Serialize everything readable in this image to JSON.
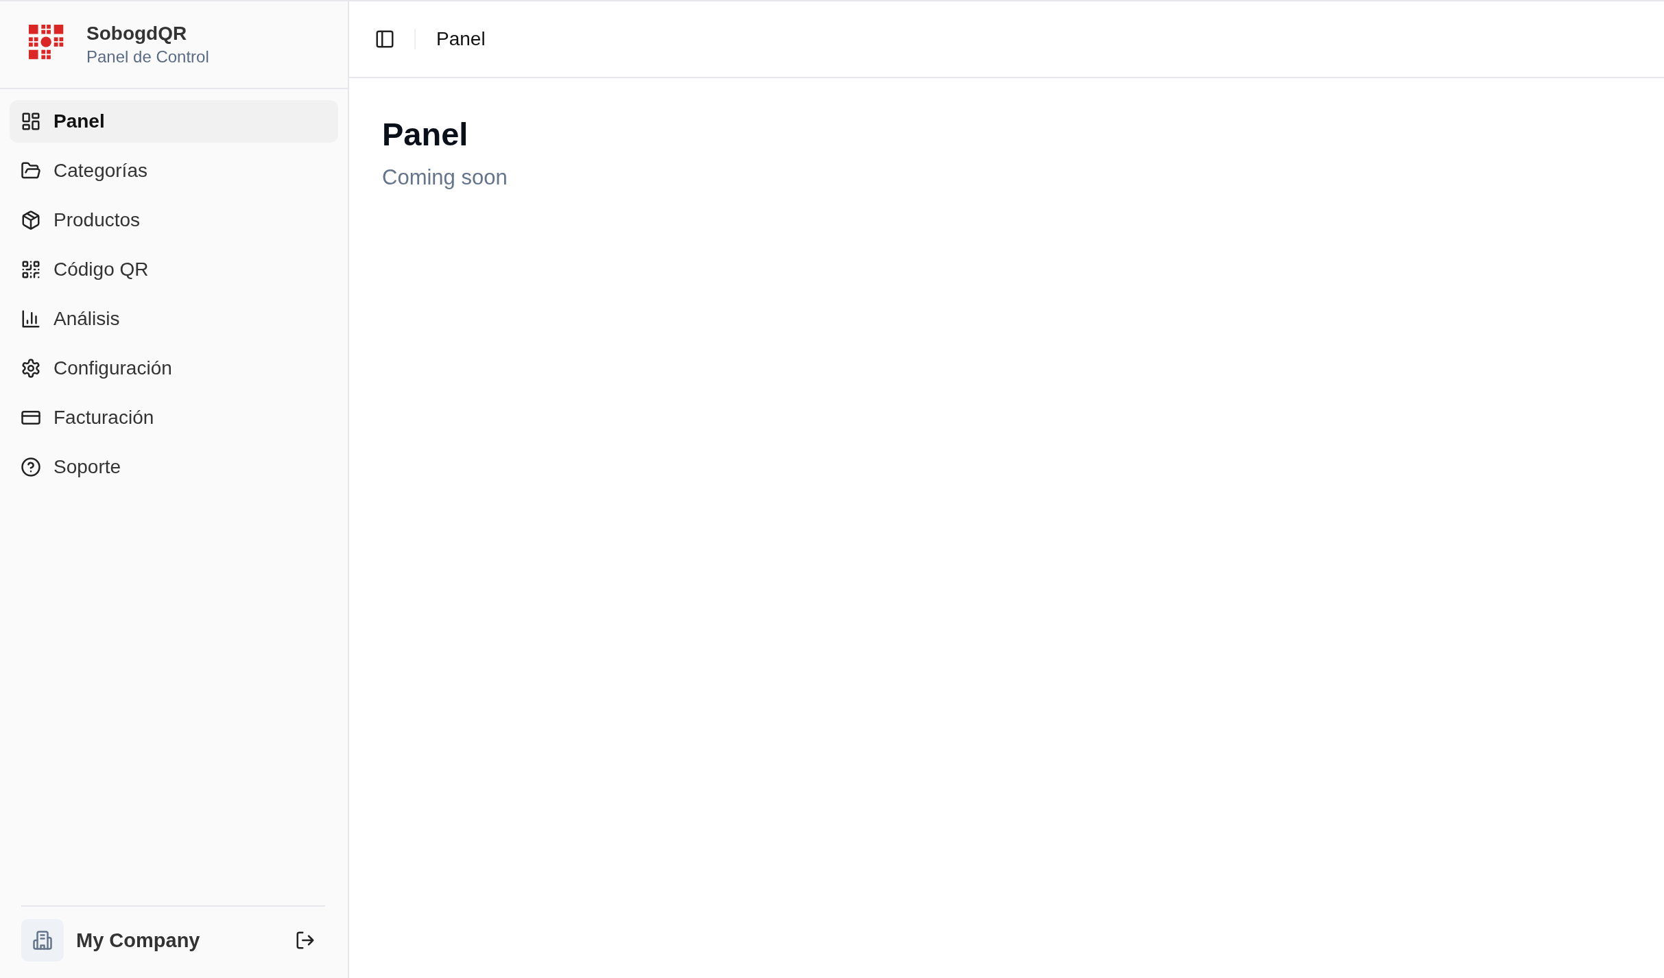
{
  "brand": {
    "name": "SobogdQR",
    "subtitle": "Panel de Control"
  },
  "sidebar": {
    "items": [
      {
        "label": "Panel",
        "selected": true
      },
      {
        "label": "Categorías",
        "selected": false
      },
      {
        "label": "Productos",
        "selected": false
      },
      {
        "label": "Código QR",
        "selected": false
      },
      {
        "label": "Análisis",
        "selected": false
      },
      {
        "label": "Configuración",
        "selected": false
      },
      {
        "label": "Facturación",
        "selected": false
      },
      {
        "label": "Soporte",
        "selected": false
      }
    ]
  },
  "footer": {
    "company": "My Company"
  },
  "header": {
    "breadcrumb": "Panel"
  },
  "content": {
    "title": "Panel",
    "subtitle": "Coming soon"
  }
}
